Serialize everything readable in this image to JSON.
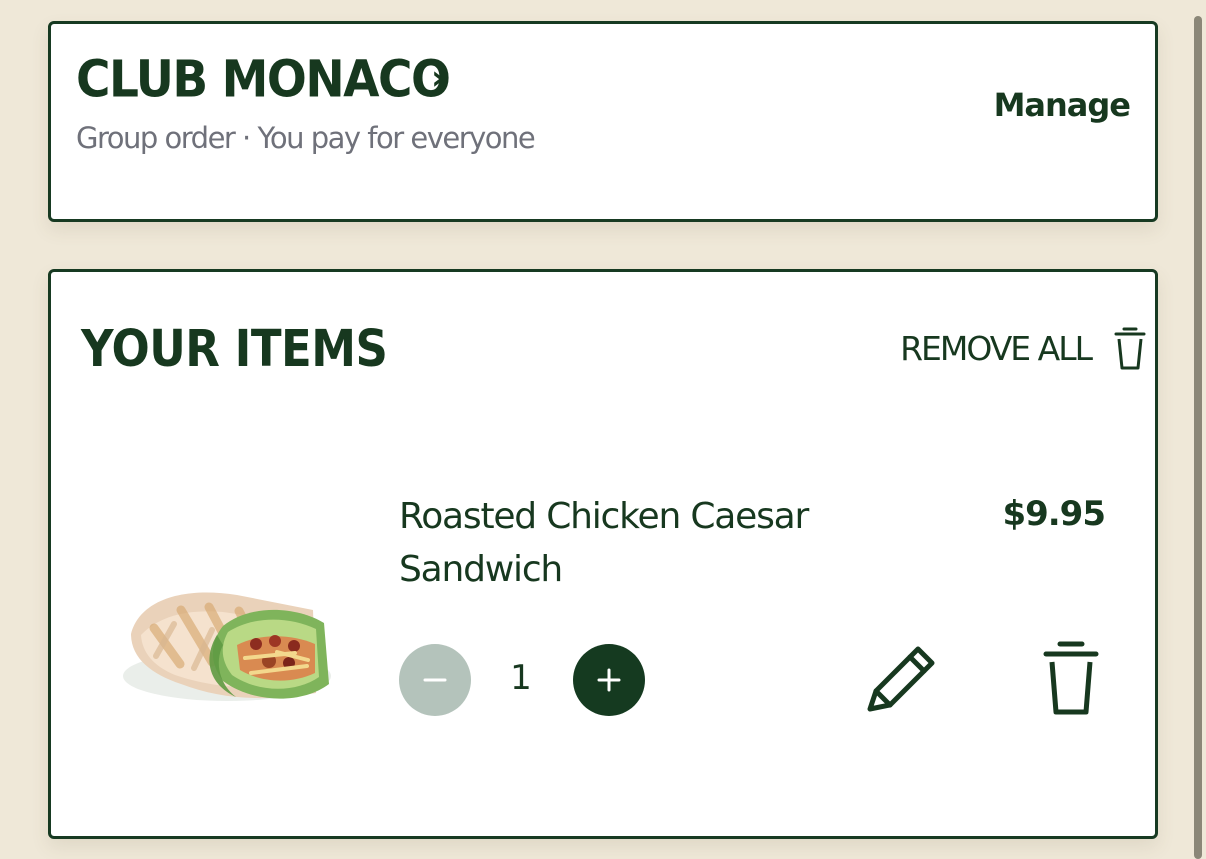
{
  "store": {
    "name": "CLUB MONACO",
    "subtitle": "Group order · You pay for everyone",
    "manage_label": "Manage"
  },
  "items_section": {
    "heading": "YOUR ITEMS",
    "remove_all_label": "REMOVE ALL"
  },
  "items": [
    {
      "name": "Roasted Chicken Caesar Sandwich",
      "price": "$9.95",
      "quantity": "1",
      "image": "chicken-caesar-wrap"
    }
  ],
  "colors": {
    "brand_green": "#17381f",
    "background": "#efe8d8",
    "muted_text": "#6f717a",
    "disabled_button": "#b4c3bb",
    "card": "#ffffff"
  },
  "icons": {
    "store_chevron": "chevron-right-icon",
    "remove_all": "trash-icon",
    "decrease": "minus-icon",
    "increase": "plus-icon",
    "edit": "pencil-icon",
    "delete": "trash-icon"
  }
}
